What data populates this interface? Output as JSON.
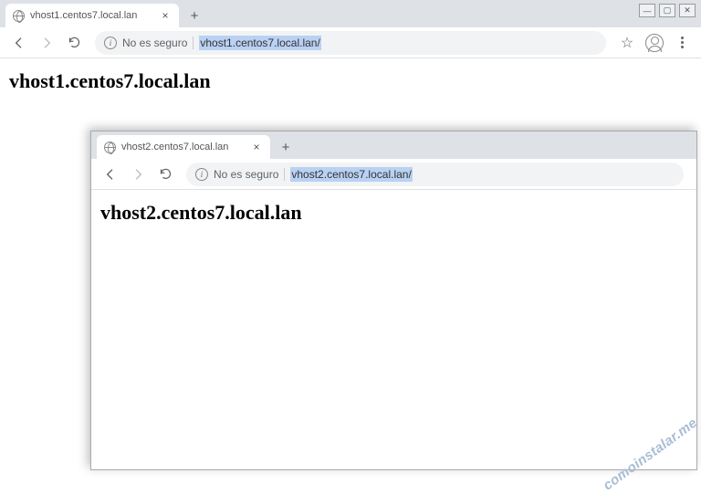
{
  "window1": {
    "tab_title": "vhost1.centos7.local.lan",
    "insecure_label": "No es seguro",
    "url": "vhost1.centos7.local.lan/",
    "page_heading": "vhost1.centos7.local.lan",
    "win_min": "—",
    "win_max": "▢",
    "win_close": "✕",
    "newtab": "+",
    "tab_close": "×",
    "star": "☆"
  },
  "window2": {
    "tab_title": "vhost2.centos7.local.lan",
    "insecure_label": "No es seguro",
    "url": "vhost2.centos7.local.lan/",
    "page_heading": "vhost2.centos7.local.lan",
    "newtab": "+",
    "tab_close": "×"
  },
  "watermark": "comoinstalar.me"
}
